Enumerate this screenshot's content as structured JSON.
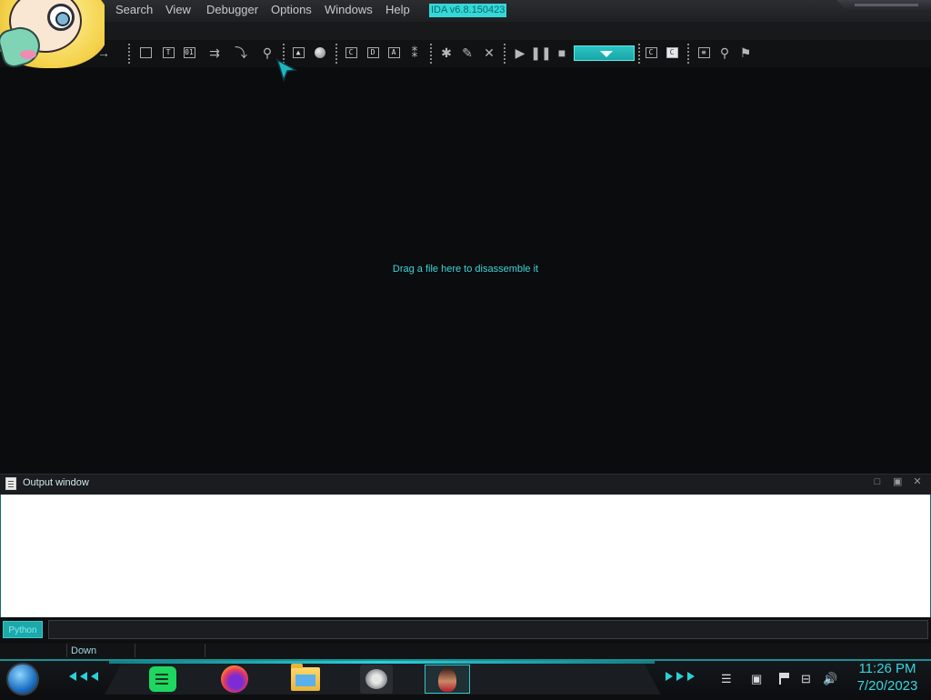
{
  "window": {
    "title": "IDA v6.8.150423"
  },
  "menu": {
    "partial_item": "p",
    "items": [
      "Search",
      "View",
      "Debugger",
      "Options",
      "Windows",
      "Help"
    ]
  },
  "toolbar": {
    "icons": [
      "back-arrow-icon",
      "forward-arrow-icon",
      "collapse-code-icon",
      "text-search-icon",
      "binary-search-icon",
      "jump-icon",
      "down-arrow-icon",
      "find-icon",
      "warning-icon",
      "circle-icon",
      "code-icon",
      "data-icon",
      "ascii-icon",
      "struct-icon",
      "cross-ref-icon",
      "patch-icon",
      "undefine-icon",
      "start-process-icon",
      "pause-icon",
      "stop-icon",
      "attach-icon",
      "c-decompile-icon",
      "c-pseudocode-icon",
      "options-icon",
      "graph-icon",
      "flow-chart-icon"
    ],
    "play_glyph": "▶",
    "pause_glyph": "❚❚",
    "stop_glyph": "■",
    "debugger_combo_value": ""
  },
  "main": {
    "drop_hint": "Drag a file here to disassemble it"
  },
  "output": {
    "title": "Output window",
    "content": "",
    "minimize_glyph": "□",
    "restore_glyph": "▣",
    "close_glyph": "✕"
  },
  "command": {
    "interpreter": "Python",
    "value": ""
  },
  "status": {
    "state": "Down"
  },
  "taskbar": {
    "apps": [
      "Spotify",
      "Firefox",
      "File Explorer",
      "IDA",
      "User"
    ],
    "clock_time": "11:26 PM",
    "clock_date": "7/20/2023",
    "accent_color": "#2ad1d8"
  },
  "colors": {
    "accent": "#35d8d8",
    "background": "#0b0c0d"
  }
}
